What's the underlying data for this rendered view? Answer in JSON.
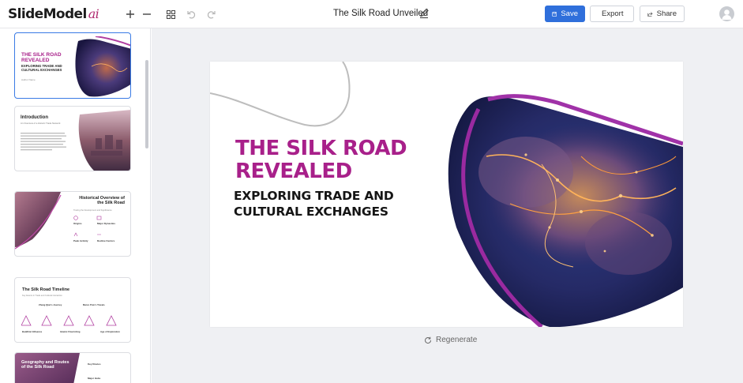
{
  "app": {
    "logo_text": "SlideModel",
    "logo_suffix": "ai",
    "document_title": "The Silk Road Unveiled"
  },
  "toolbar": {
    "icons": [
      "zoom-in-icon",
      "zoom-out-icon",
      "grid-icon",
      "undo-icon",
      "redo-icon"
    ],
    "save_label": "Save",
    "export_label": "Export",
    "share_label": "Share"
  },
  "thumbnails": [
    {
      "title_line1": "THE SILK ROAD",
      "title_line2": "REVEALED",
      "subtitle_line1": "EXPLORING TRADE AND",
      "subtitle_line2": "CULTURAL EXCHANGES",
      "author": "Author Name"
    },
    {
      "title": "Introduction",
      "subtitle": "An Overview of a Historic Trade Network",
      "number": "2"
    },
    {
      "title_line1": "Historical Overview of",
      "title_line2": "the Silk Road",
      "subtitle": "Tracing the Development and Significance",
      "items": [
        "Origins",
        "Major Dynasties",
        "Peak Activity",
        "Decline Factors"
      ],
      "number": "3"
    },
    {
      "title": "The Silk Road Timeline",
      "subtitle": "Key Events in Trade and Cultural Interaction",
      "top_labels": [
        "Zhang Qian's Journey",
        "Marco Polo's Travels"
      ],
      "bottom_labels": [
        "Buddhist Influence",
        "Islamic Flourishing",
        "Age of Exploration"
      ]
    },
    {
      "title_line1": "Geography and Routes",
      "title_line2": "of the Silk Road",
      "items": [
        "Key Routes",
        "Major Hubs"
      ]
    }
  ],
  "slide": {
    "title_line1": "THE SILK ROAD",
    "title_line2": "REVEALED",
    "subtitle_line1": "EXPLORING TRADE AND",
    "subtitle_line2": "CULTURAL EXCHANGES"
  },
  "regenerate_label": "Regenerate",
  "colors": {
    "accent_purple": "#a8208a",
    "primary_blue": "#2f6fdb",
    "canvas_bg": "#eff0f3"
  }
}
